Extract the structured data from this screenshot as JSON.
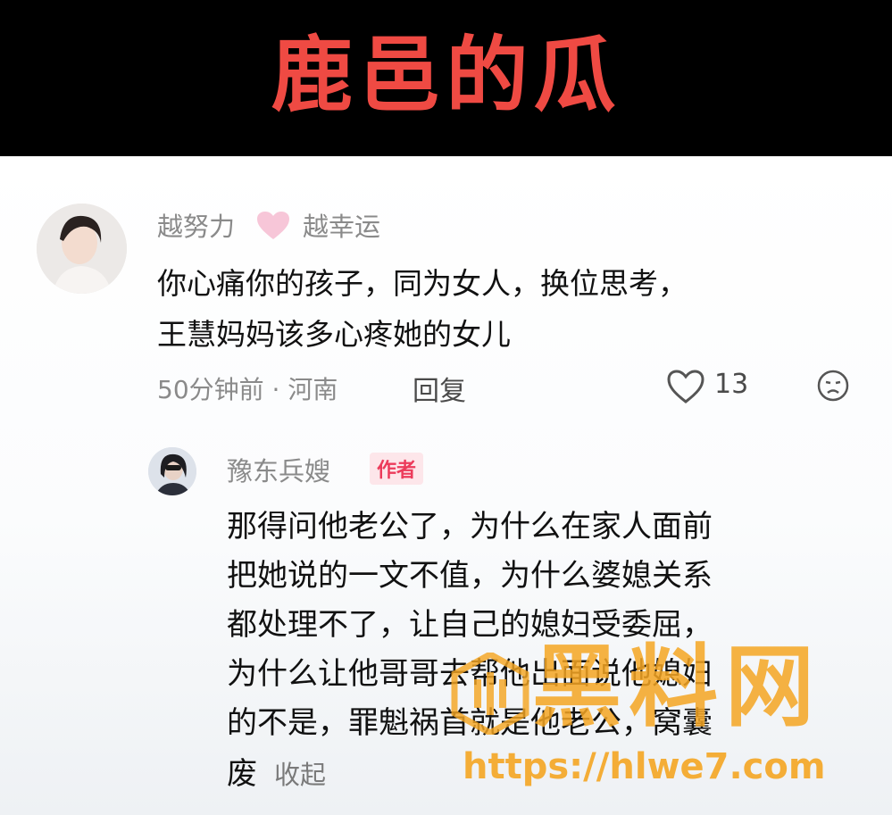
{
  "banner": {
    "title": "鹿邑的瓜"
  },
  "comment": {
    "username": "越努力",
    "username_suffix": "越幸运",
    "lines": [
      "你心痛你的孩子，同为女人，换位思考，",
      "王慧妈妈该多心疼她的女儿"
    ],
    "meta": "50分钟前 · 河南",
    "reply_label": "回复",
    "like_count": "13"
  },
  "reply": {
    "username": "豫东兵嫂",
    "badge": "作者",
    "lines": [
      "那得问他老公了，为什么在家人面前",
      "把她说的一文不值，为什么婆媳关系",
      "都处理不了，让自己的媳妇受委屈，",
      "为什么让他哥哥去帮他出面说他媳妇",
      "的不是，罪魁祸首就是他老公，窝囊",
      "废"
    ],
    "collapse_label": "收起"
  },
  "watermark": {
    "text": "黑料网",
    "url": "https://hlwe7.com"
  },
  "colors": {
    "banner_bg": "#000000",
    "banner_title": "#ef4a43",
    "badge": "#ec3b5b",
    "watermark": "#f5a623"
  }
}
